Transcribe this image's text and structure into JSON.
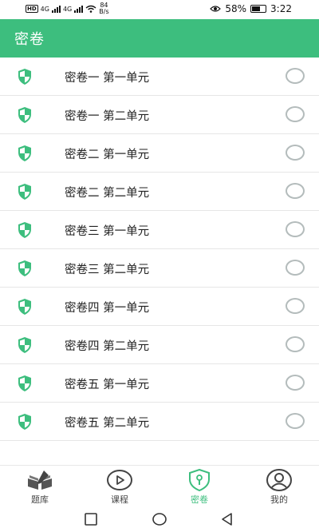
{
  "status_bar": {
    "network_speed_value": "84",
    "network_speed_unit": "B/s",
    "battery_percent": "58%",
    "time": "3:22",
    "sim1_type": "4G",
    "sim2_type": "4G",
    "hd_label": "HD"
  },
  "app_bar": {
    "title": "密卷"
  },
  "papers": [
    {
      "label": "密卷一 第一单元",
      "selected": false
    },
    {
      "label": "密卷一 第二单元",
      "selected": false
    },
    {
      "label": "密卷二 第一单元",
      "selected": false
    },
    {
      "label": "密卷二 第二单元",
      "selected": false
    },
    {
      "label": "密卷三 第一单元",
      "selected": false
    },
    {
      "label": "密卷三 第二单元",
      "selected": false
    },
    {
      "label": "密卷四 第一单元",
      "selected": false
    },
    {
      "label": "密卷四 第二单元",
      "selected": false
    },
    {
      "label": "密卷五 第一单元",
      "selected": false
    },
    {
      "label": "密卷五 第二单元",
      "selected": false
    }
  ],
  "bottom_nav": [
    {
      "label": "题库",
      "icon": "book-icon",
      "active": false
    },
    {
      "label": "课程",
      "icon": "play-icon",
      "active": false
    },
    {
      "label": "密卷",
      "icon": "shield-lock-icon",
      "active": true
    },
    {
      "label": "我的",
      "icon": "user-icon",
      "active": false
    }
  ],
  "colors": {
    "accent": "#3dbe7e",
    "radio_border": "#b4bcbc",
    "text": "#222222"
  }
}
